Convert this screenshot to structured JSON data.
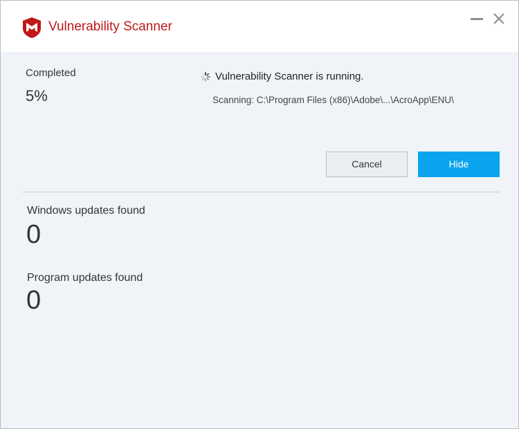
{
  "titlebar": {
    "title": "Vulnerability Scanner",
    "brand_color": "#c01818",
    "minimize_icon": "minimize-icon",
    "close_icon": "close-icon"
  },
  "progress": {
    "label": "Completed",
    "value_text": "5%",
    "percent": 5
  },
  "status": {
    "icon": "spinner-icon",
    "text": "Vulnerability Scanner is running.",
    "scanning_path": "Scanning: C:\\Program Files (x86)\\Adobe\\...\\AcroApp\\ENU\\"
  },
  "buttons": {
    "cancel_label": "Cancel",
    "hide_label": "Hide",
    "hide_color": "#0aa5ee"
  },
  "results": {
    "windows_label": "Windows updates found",
    "windows_count": "0",
    "program_label": "Program updates found",
    "program_count": "0"
  }
}
